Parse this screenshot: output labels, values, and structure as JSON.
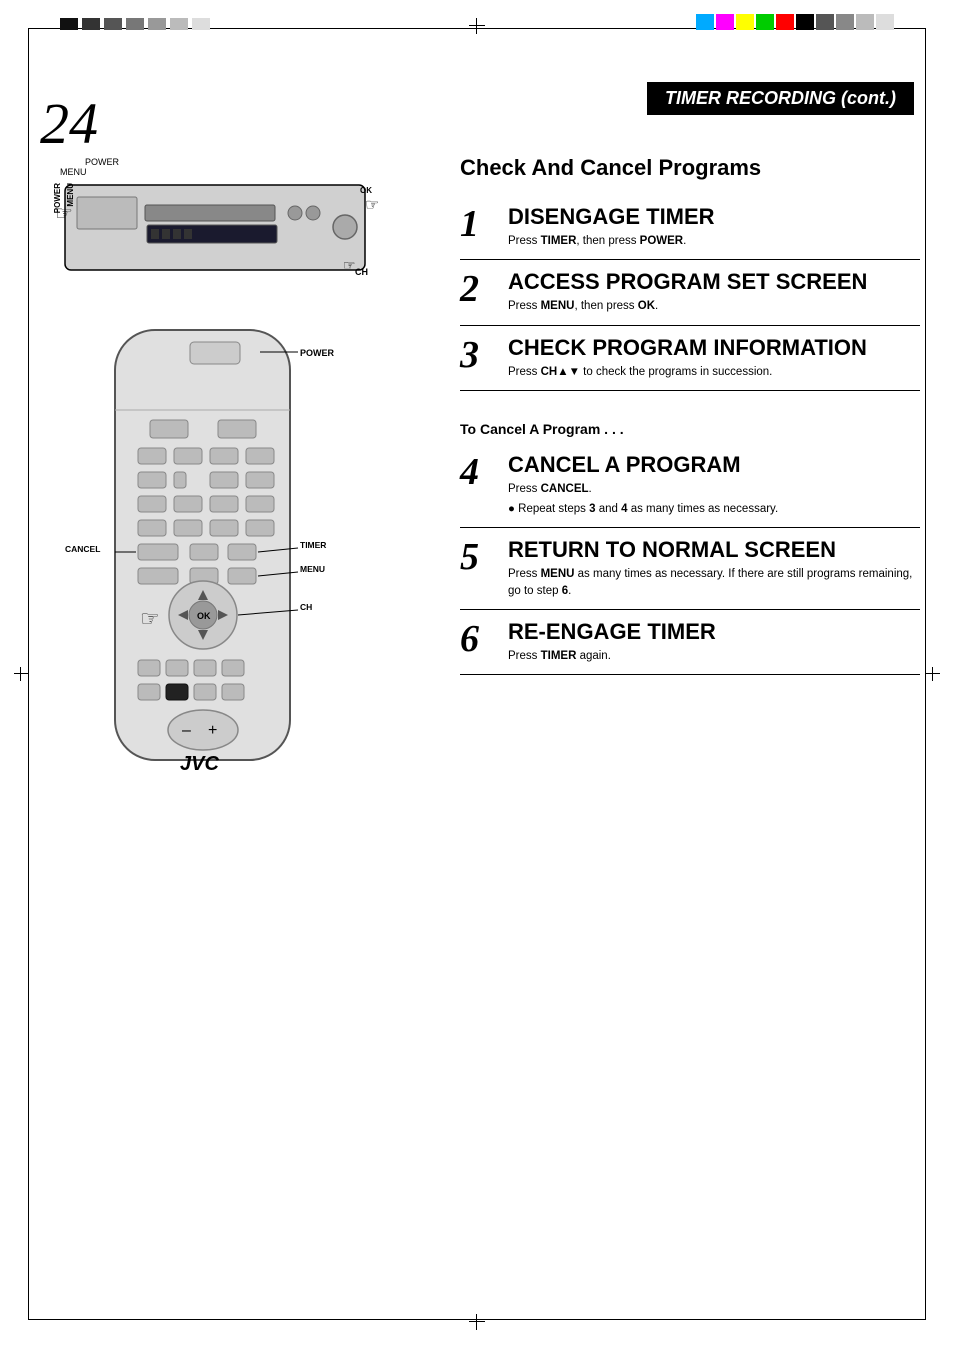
{
  "page": {
    "number": "24",
    "header_title": "TIMER RECORDING (cont.)",
    "section_title": "Check And Cancel Programs"
  },
  "steps": [
    {
      "number": "1",
      "heading": "DISENGAGE TIMER",
      "text_parts": [
        {
          "type": "plain",
          "text": "Press "
        },
        {
          "type": "bold",
          "text": "TIMER"
        },
        {
          "type": "plain",
          "text": ", then press "
        },
        {
          "type": "bold",
          "text": "POWER"
        },
        {
          "type": "plain",
          "text": "."
        }
      ]
    },
    {
      "number": "2",
      "heading": "ACCESS PROGRAM SET SCREEN",
      "text_parts": [
        {
          "type": "plain",
          "text": "Press "
        },
        {
          "type": "bold",
          "text": "MENU"
        },
        {
          "type": "plain",
          "text": ", then press "
        },
        {
          "type": "bold",
          "text": "OK"
        },
        {
          "type": "plain",
          "text": "."
        }
      ]
    },
    {
      "number": "3",
      "heading": "CHECK PROGRAM INFORMATION",
      "text_parts": [
        {
          "type": "plain",
          "text": "Press "
        },
        {
          "type": "bold",
          "text": "CH▲▼"
        },
        {
          "type": "plain",
          "text": " to check the programs in succession."
        }
      ]
    }
  ],
  "cancel_section": {
    "title": "To Cancel A Program . . .",
    "steps": [
      {
        "number": "4",
        "heading": "CANCEL A PROGRAM",
        "text_parts": [
          {
            "type": "plain",
            "text": "Press "
          },
          {
            "type": "bold",
            "text": "CANCEL"
          },
          {
            "type": "plain",
            "text": "."
          }
        ],
        "bullet": "Repeat steps 3 and 4 as many times as necessary."
      },
      {
        "number": "5",
        "heading": "RETURN TO NORMAL SCREEN",
        "text_parts": [
          {
            "type": "plain",
            "text": "Press "
          },
          {
            "type": "bold",
            "text": "MENU"
          },
          {
            "type": "plain",
            "text": " as many times as necessary. If there are still programs remaining, go to step "
          },
          {
            "type": "bold",
            "text": "6"
          },
          {
            "type": "plain",
            "text": "."
          }
        ]
      },
      {
        "number": "6",
        "heading": "RE-ENGAGE TIMER",
        "text_parts": [
          {
            "type": "plain",
            "text": "Press "
          },
          {
            "type": "bold",
            "text": "TIMER"
          },
          {
            "type": "plain",
            "text": " again."
          }
        ]
      }
    ]
  },
  "device_labels": {
    "power": "POWER",
    "menu": "MENU",
    "ok": "OK",
    "ch": "CH",
    "timer": "TIMER",
    "cancel": "CANCEL",
    "jvc": "JVC"
  }
}
